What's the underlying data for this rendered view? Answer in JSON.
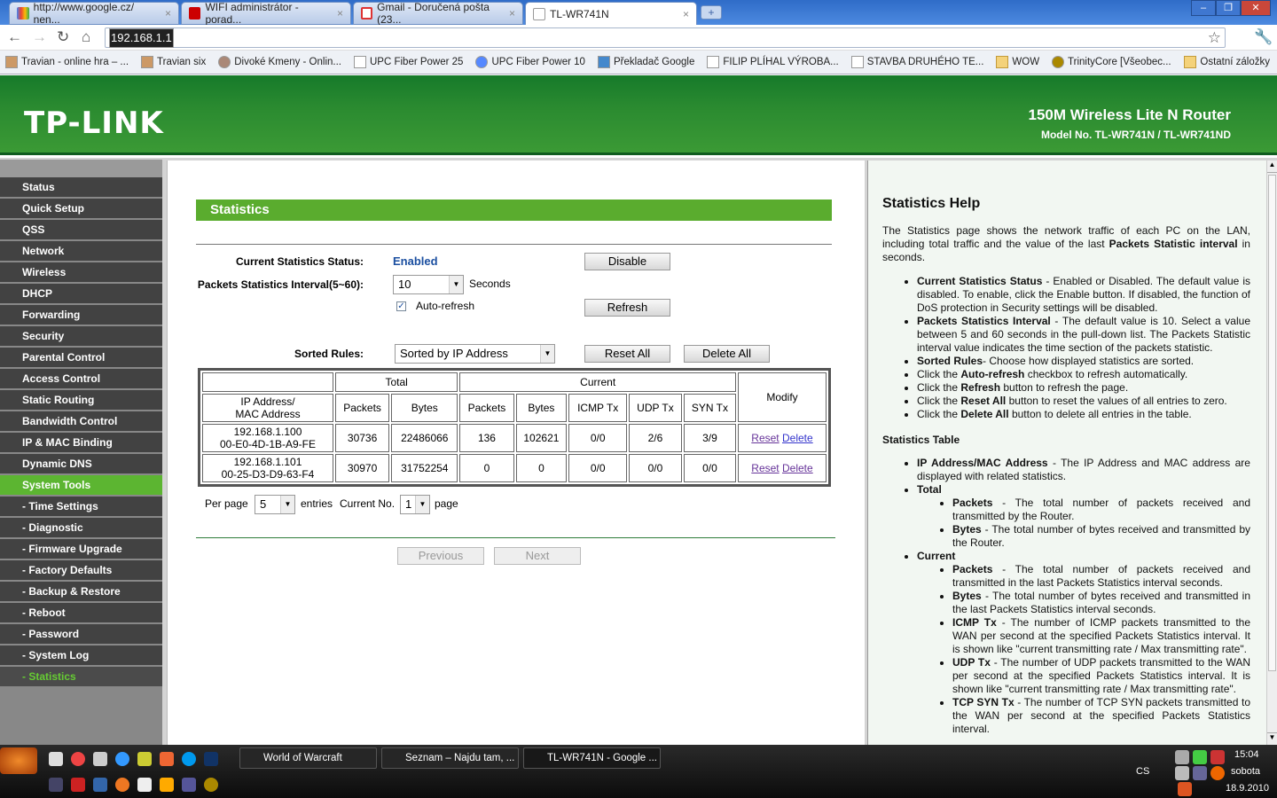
{
  "browser": {
    "tabs": [
      {
        "label": "http://www.google.cz/ nen...",
        "icon": "google-icon"
      },
      {
        "label": "WIFI administrátor - porad...",
        "icon": "pnet-icon"
      },
      {
        "label": "Gmail - Doručená pošta (23...",
        "icon": "gmail-icon"
      },
      {
        "label": "TL-WR741N",
        "icon": "page-icon"
      }
    ],
    "new_tab": "+",
    "url": "192.168.1.1",
    "bookmarks": [
      "Travian - online hra – ...",
      "Travian six",
      "Divoké Kmeny - Onlin...",
      "UPC Fiber Power 25",
      "UPC Fiber Power 10",
      "Překladač Google",
      "FILIP PLÍHAL VÝROBA...",
      "STAVBA DRUHÉHO TE...",
      "WOW",
      "TrinityCore [Všeobec..."
    ],
    "other_bookmarks": "Ostatní záložky"
  },
  "banner": {
    "logo": "TP-LINK",
    "product": "150M Wireless Lite N Router",
    "model": "Model No. TL-WR741N / TL-WR741ND"
  },
  "sidebar": {
    "items": [
      "Status",
      "Quick Setup",
      "QSS",
      "Network",
      "Wireless",
      "DHCP",
      "Forwarding",
      "Security",
      "Parental Control",
      "Access Control",
      "Static Routing",
      "Bandwidth Control",
      "IP & MAC Binding",
      "Dynamic DNS",
      "System Tools",
      "- Time Settings",
      "- Diagnostic",
      "- Firmware Upgrade",
      "- Factory Defaults",
      "- Backup & Restore",
      "- Reboot",
      "- Password",
      "- System Log",
      "- Statistics"
    ],
    "active": "System Tools",
    "current": "- Statistics"
  },
  "main": {
    "title": "Statistics",
    "status_label": "Current Statistics Status:",
    "status_value": "Enabled",
    "disable_btn": "Disable",
    "interval_label": "Packets Statistics Interval(5~60):",
    "interval_value": "10",
    "seconds": "Seconds",
    "autorefresh": "Auto-refresh",
    "autorefresh_checked": true,
    "refresh_btn": "Refresh",
    "sorted_label": "Sorted Rules:",
    "sorted_value": "Sorted by IP Address",
    "reset_all": "Reset All",
    "delete_all": "Delete All",
    "table": {
      "group_total": "Total",
      "group_current": "Current",
      "modify": "Modify",
      "headers": [
        "IP Address/",
        "MAC Address",
        "Packets",
        "Bytes",
        "Packets",
        "Bytes",
        "ICMP Tx",
        "UDP Tx",
        "SYN Tx"
      ],
      "rows": [
        {
          "ip": "192.168.1.100",
          "mac": "00-E0-4D-1B-A9-FE",
          "tp": "30736",
          "tb": "22486066",
          "cp": "136",
          "cb": "102621",
          "icmp": "0/0",
          "udp": "2/6",
          "syn": "3/9"
        },
        {
          "ip": "192.168.1.101",
          "mac": "00-25-D3-D9-63-F4",
          "tp": "30970",
          "tb": "31752254",
          "cp": "0",
          "cb": "0",
          "icmp": "0/0",
          "udp": "0/0",
          "syn": "0/0"
        }
      ],
      "reset": "Reset",
      "delete": "Delete"
    },
    "per_page": "Per page",
    "per_page_value": "5",
    "entries": "entries",
    "current_no": "Current No.",
    "current_no_value": "1",
    "page": "page",
    "previous": "Previous",
    "next": "Next"
  },
  "help": {
    "title": "Statistics Help",
    "intro_a": "The Statistics page shows the network traffic of each PC on the LAN, including total traffic and the value of the last ",
    "intro_b": "Packets Statistic interval",
    "intro_c": " in seconds.",
    "items": [
      {
        "pre": "",
        "term": "Current Statistics Status",
        "text": " - Enabled or Disabled. The default value is disabled. To enable, click the Enable button. If disabled, the function of DoS protection in Security settings will be disabled."
      },
      {
        "pre": "",
        "term": "Packets Statistics Interval",
        "text": " - The default value is 10. Select a value between 5 and 60 seconds in the pull-down list. The Packets Statistic interval value indicates the time section of the packets statistic."
      },
      {
        "pre": "",
        "term": "Sorted Rules",
        "text": "- Choose how displayed statistics are sorted."
      },
      {
        "pre": "Click the ",
        "term": "Auto-refresh",
        "text": " checkbox to refresh automatically."
      },
      {
        "pre": "Click the ",
        "term": "Refresh",
        "text": " button to refresh the page."
      },
      {
        "pre": "Click the ",
        "term": "Reset All",
        "text": " button to reset the values of all entries to zero."
      },
      {
        "pre": "Click the ",
        "term": "Delete All",
        "text": " button to delete all entries in the table."
      }
    ],
    "table_title": "Statistics Table",
    "ipmac": {
      "term": "IP Address/MAC Address",
      "text": " - The IP Address and MAC address are displayed with related statistics."
    },
    "total": "Total",
    "total_items": [
      {
        "term": "Packets",
        "text": " - The total number of packets received and transmitted by the Router."
      },
      {
        "term": "Bytes",
        "text": " - The total number of bytes received and transmitted by the Router."
      }
    ],
    "current": "Current",
    "current_items": [
      {
        "term": "Packets",
        "text": " - The total number of packets received and transmitted in the last Packets Statistics interval seconds."
      },
      {
        "term": "Bytes",
        "text": " - The total number of bytes received and transmitted in the last Packets Statistics interval seconds."
      },
      {
        "term": "ICMP Tx",
        "text": " - The number of ICMP packets transmitted to the WAN per second at the specified Packets Statistics interval. It is shown like \"current transmitting rate / Max transmitting rate\"."
      },
      {
        "term": "UDP Tx",
        "text": " - The number of UDP packets transmitted to the WAN per second at the specified Packets Statistics interval. It is shown like \"current transmitting rate / Max transmitting rate\"."
      },
      {
        "term": "TCP SYN Tx",
        "text": " - The number of TCP SYN packets transmitted to the WAN per second at the specified Packets Statistics interval."
      }
    ]
  },
  "taskbar": {
    "tasks": [
      "World of Warcraft",
      "Seznam – Najdu tam, ...",
      "TL-WR741N - Google ..."
    ],
    "lang": "CS",
    "time": "15:04",
    "day": "sobota",
    "date": "18.9.2010"
  },
  "colors": {
    "brand_green": "#5aac2e",
    "sidebar_dark": "#424242",
    "link": "#3333cc"
  }
}
